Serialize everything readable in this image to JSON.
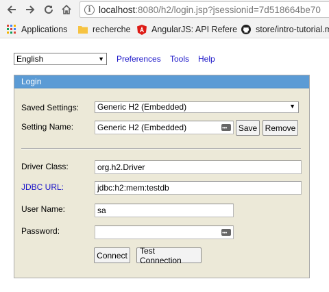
{
  "browser": {
    "url_host": "localhost",
    "url_rest": ":8080/h2/login.jsp?jsessionid=7d518664be70",
    "bookmarks": [
      {
        "label": "Applications"
      },
      {
        "label": "recherche"
      },
      {
        "label": "AngularJS: API Refere"
      },
      {
        "label": "store/intro-tutorial.m"
      }
    ]
  },
  "page": {
    "language": {
      "selected": "English"
    },
    "links": {
      "preferences": "Preferences",
      "tools": "Tools",
      "help": "Help"
    },
    "login": {
      "header": "Login",
      "saved_settings_label": "Saved Settings:",
      "saved_settings_value": "Generic H2 (Embedded)",
      "setting_name_label": "Setting Name:",
      "setting_name_value": "Generic H2 (Embedded)",
      "save_button": "Save",
      "remove_button": "Remove",
      "driver_class_label": "Driver Class:",
      "driver_class_value": "org.h2.Driver",
      "jdbc_url_label": "JDBC URL:",
      "jdbc_url_value": "jdbc:h2:mem:testdb",
      "user_name_label": "User Name:",
      "user_name_value": "sa",
      "password_label": "Password:",
      "password_value": "",
      "connect_button": "Connect",
      "test_connection_button": "Test Connection"
    }
  },
  "colors": {
    "panel_header": "#5b9bd5",
    "panel_bg": "#ece9d8",
    "link": "#1a14c8"
  }
}
